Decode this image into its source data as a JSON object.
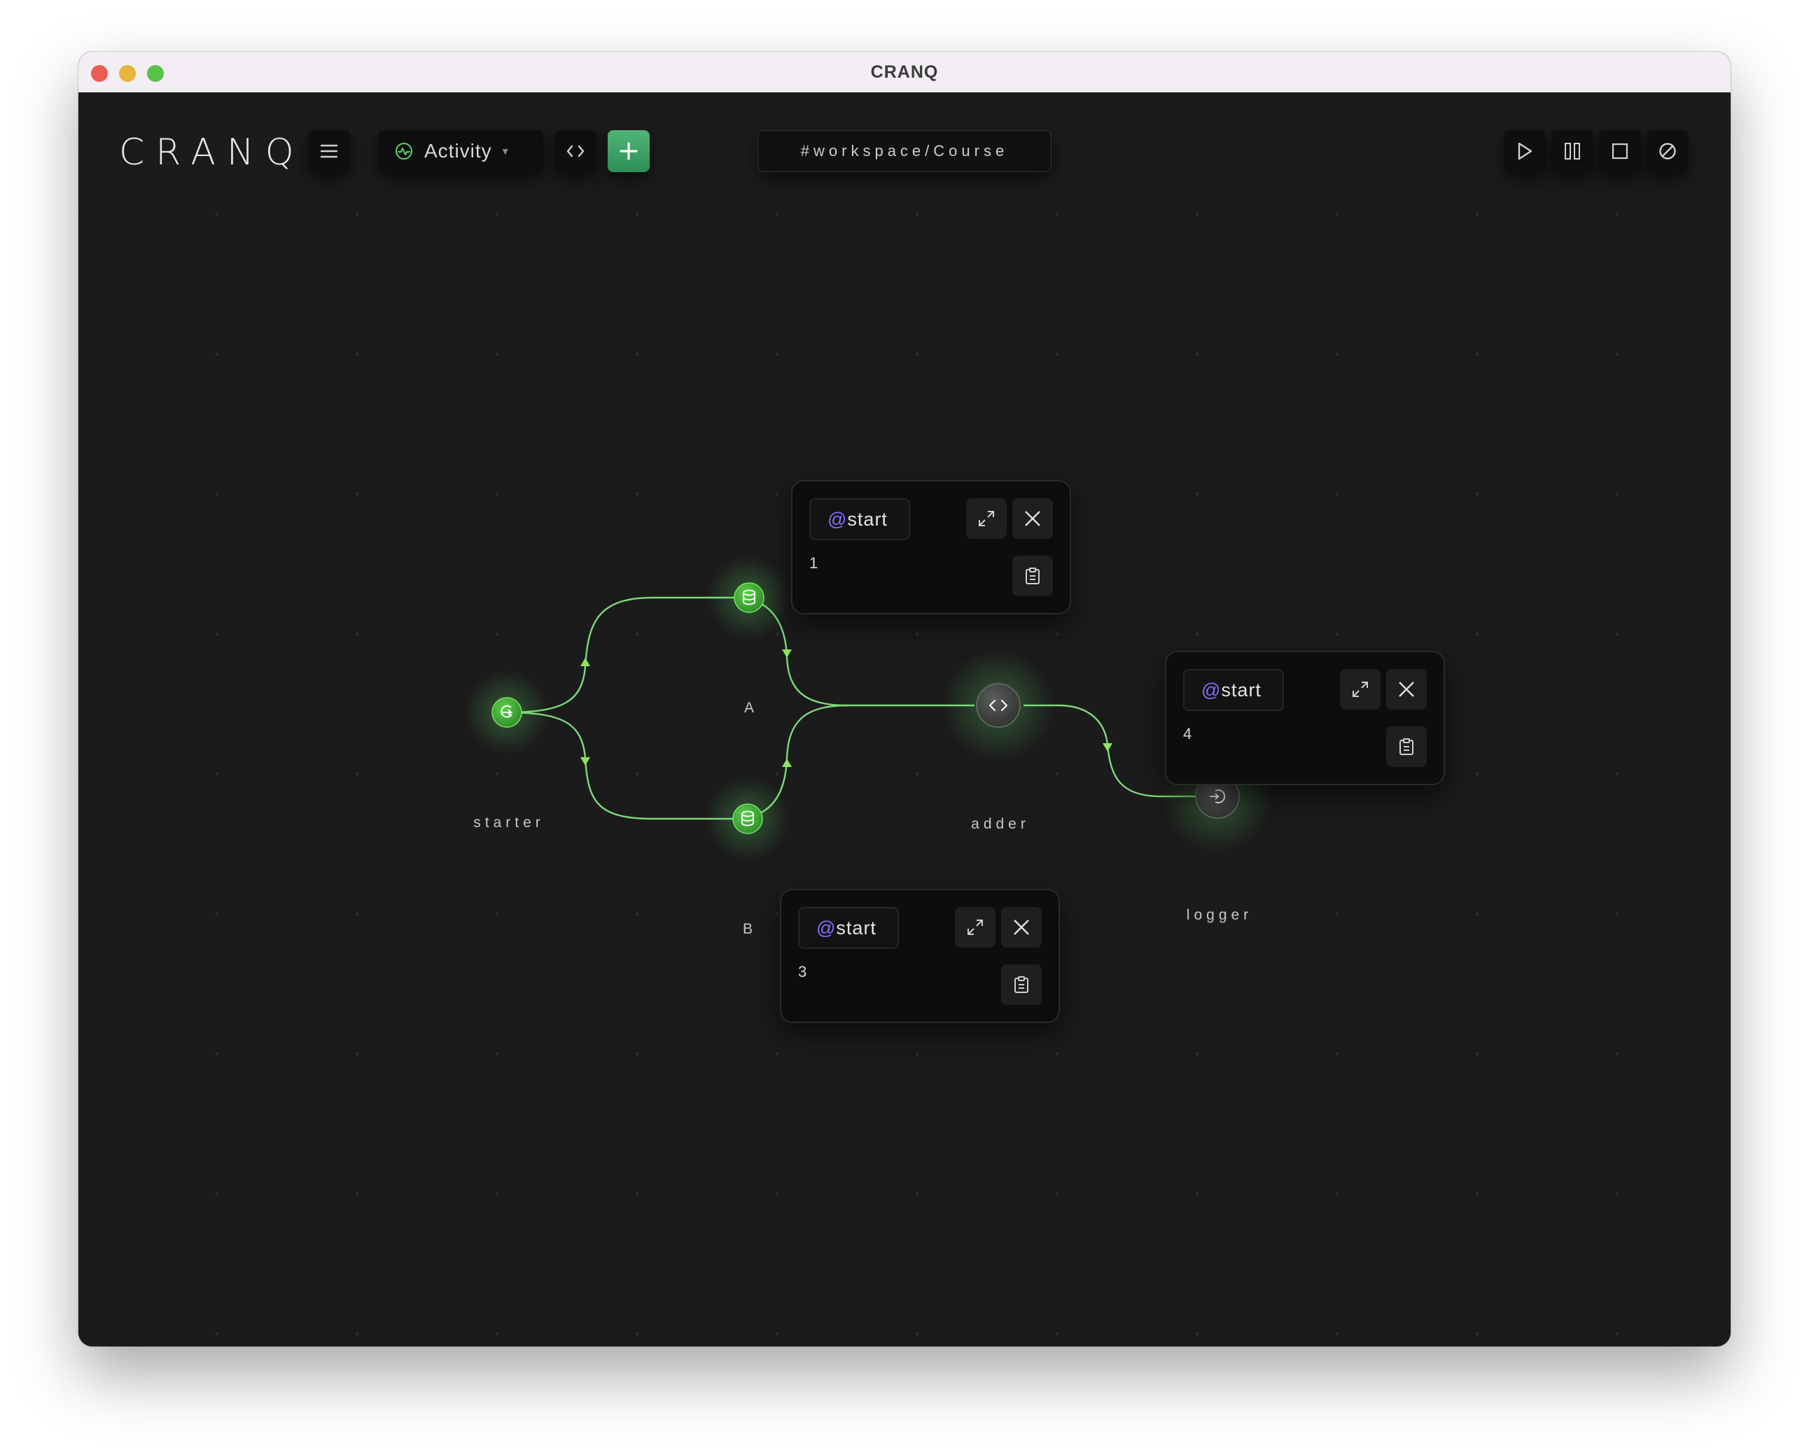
{
  "window": {
    "title": "CRANQ"
  },
  "toolbar": {
    "logo": "CRANQ",
    "menu_icon": "hamburger-icon",
    "activity_label": "Activity",
    "workspace_path": "#workspace/Course",
    "controls": [
      "play-icon",
      "pause-icon",
      "stop-icon",
      "disable-icon"
    ]
  },
  "graph": {
    "nodes": [
      {
        "id": "starter",
        "label": "starter",
        "icon": "start-icon"
      },
      {
        "id": "A",
        "label": "A",
        "icon": "database-icon"
      },
      {
        "id": "B",
        "label": "B",
        "icon": "database-icon"
      },
      {
        "id": "adder",
        "label": "adder",
        "icon": "code-icon"
      },
      {
        "id": "logger",
        "label": "logger",
        "icon": "log-icon"
      }
    ],
    "accent_color": "#5fd36a"
  },
  "popups": [
    {
      "port_prefix": "@",
      "port_name": "start",
      "value": "1"
    },
    {
      "port_prefix": "@",
      "port_name": "start",
      "value": "4"
    },
    {
      "port_prefix": "@",
      "port_name": "start",
      "value": "3"
    }
  ]
}
